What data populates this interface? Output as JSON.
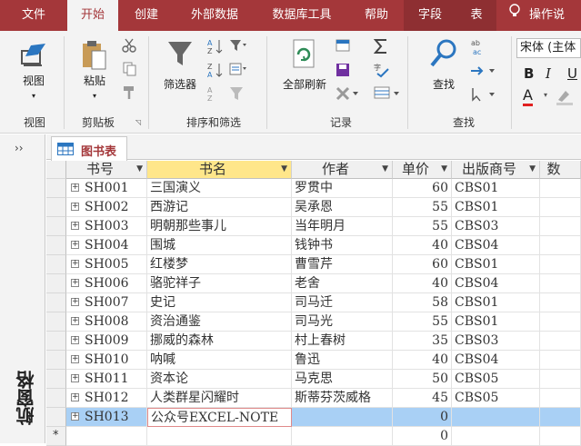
{
  "tabs": [
    "文件",
    "开始",
    "创建",
    "外部数据",
    "数据库工具",
    "帮助",
    "字段",
    "表",
    "操作说"
  ],
  "active_tab": "开始",
  "ribbon": {
    "view_label": "视图",
    "paste_label": "粘贴",
    "filter_label": "筛选器",
    "refresh_label": "全部刷新",
    "find_label": "查找",
    "font_name": "宋体 (主体",
    "bold": "B",
    "italic": "I",
    "underline": "U",
    "font_color": "A",
    "groups": [
      "视图",
      "剪贴板",
      "排序和筛选",
      "记录",
      "查找"
    ]
  },
  "nav_pane": {
    "chevron": "››",
    "title": "航窗格"
  },
  "document_tab": "图书表",
  "columns": [
    "书号",
    "书名",
    "作者",
    "单价",
    "出版商号",
    "数"
  ],
  "rows": [
    [
      "SH001",
      "三国演义",
      "罗贯中",
      "60",
      "CBS01"
    ],
    [
      "SH002",
      "西游记",
      "吴承恩",
      "55",
      "CBS01"
    ],
    [
      "SH003",
      "明朝那些事儿",
      "当年明月",
      "55",
      "CBS03"
    ],
    [
      "SH004",
      "围城",
      "钱钟书",
      "40",
      "CBS04"
    ],
    [
      "SH005",
      "红楼梦",
      "曹雪芹",
      "60",
      "CBS01"
    ],
    [
      "SH006",
      "骆驼祥子",
      "老舍",
      "40",
      "CBS04"
    ],
    [
      "SH007",
      "史记",
      "司马迁",
      "58",
      "CBS01"
    ],
    [
      "SH008",
      "资治通鉴",
      "司马光",
      "55",
      "CBS01"
    ],
    [
      "SH009",
      "挪威的森林",
      "村上春树",
      "35",
      "CBS03"
    ],
    [
      "SH010",
      "呐喊",
      "鲁迅",
      "40",
      "CBS04"
    ],
    [
      "SH011",
      "资本论",
      "马克思",
      "50",
      "CBS05"
    ],
    [
      "SH012",
      "人类群星闪耀时",
      "斯蒂芬茨威格",
      "45",
      "CBS05"
    ],
    [
      "SH013",
      "公众号EXCEL-NOTE",
      "",
      "0",
      ""
    ],
    [
      "",
      "",
      "",
      "0",
      ""
    ]
  ],
  "new_row_marker": "*",
  "colors": {
    "accent": "#a4373a",
    "selected_header": "#ffe68a",
    "selected_row": "#a9d0f5"
  }
}
